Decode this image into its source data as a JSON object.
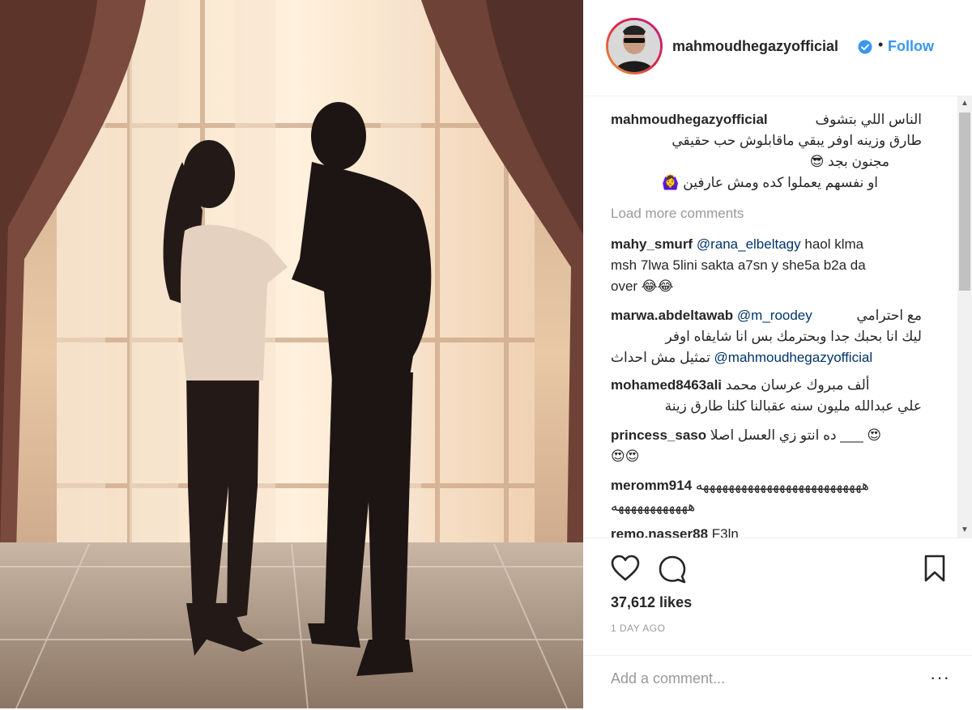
{
  "post": {
    "username": "mahmoudhegazyofficial",
    "separator": "•",
    "follow_label": "Follow"
  },
  "caption": {
    "username": "mahmoudhegazyofficial",
    "lines": [
      "الناس اللي بتشوف",
      "طارق وزينه اوفر يبقي ماقابلوش حب حقيقي",
      "مجنون بجد 😎",
      "او نفسهم يعملوا كده ومش عارفين 🙆‍♀️"
    ]
  },
  "load_more": "Load more comments",
  "comments": [
    {
      "username": "mahy_smurf",
      "mention": "@rana_elbeltagy",
      "text1": "haol klma",
      "text2": "msh 7lwa 5lini sakta a7sn y she5a b2a da",
      "text3": "over 😂😂"
    },
    {
      "username": "marwa.abdeltawab",
      "mention": "@m_roodey",
      "text1": "مع احترامي",
      "text2": "ليك انا بحبك جدا وبحترمك بس انا شايفاه اوفر",
      "text3": "تمثيل مش احداث",
      "mention2": "@mahmoudhegazyofficial"
    },
    {
      "username": "mohamed8463ali",
      "text1": "ألف مبروك عرسان محمد",
      "text2": "علي عبدالله مليون سنه عقبالنا كلنا طارق زينة"
    },
    {
      "username": "princess_saso",
      "text1": "ده انتو زي العسل اصلا ___",
      "emoji1": "😍",
      "text2": "😍😍"
    },
    {
      "username": "meromm914",
      "text1": "ههههههههههههههههههههههههههه",
      "text2": "ههههههههههههه"
    },
    {
      "username": "remo.nasser88",
      "text1": "F3ln"
    }
  ],
  "likes": "37,612 likes",
  "time_ago": "1 DAY AGO",
  "add_comment_placeholder": "Add a comment...",
  "more_label": "···",
  "scroll": {
    "up": "▲",
    "down": "▼"
  },
  "icons": [
    "heart-icon",
    "comment-icon",
    "bookmark-icon",
    "verified-badge-icon"
  ],
  "colors": {
    "link": "#3897f0",
    "mention": "#003569",
    "verified": "#3897f0",
    "muted": "#999999"
  }
}
